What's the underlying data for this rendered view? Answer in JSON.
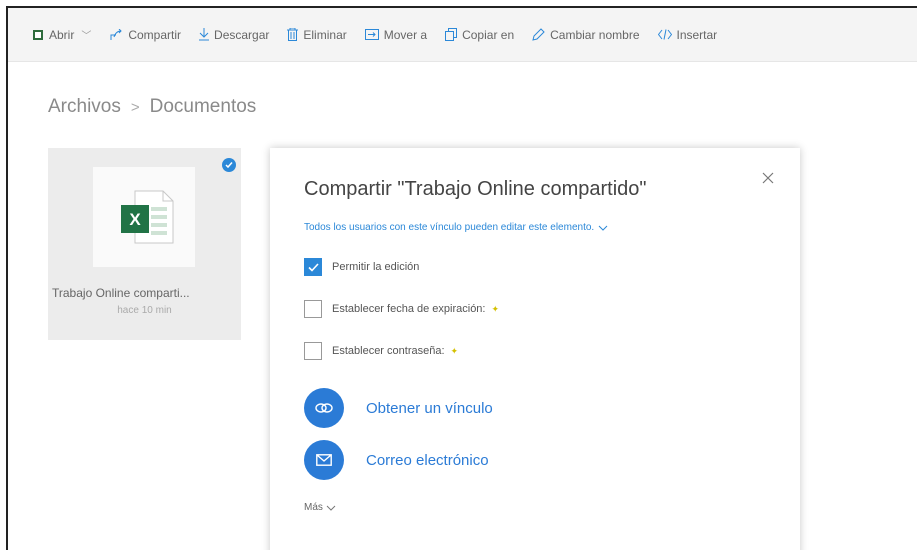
{
  "toolbar": {
    "items": [
      {
        "label": "Abrir",
        "icon": "open-icon"
      },
      {
        "label": "Compartir",
        "icon": "share-icon"
      },
      {
        "label": "Descargar",
        "icon": "download-icon"
      },
      {
        "label": "Eliminar",
        "icon": "trash-icon"
      },
      {
        "label": "Mover a",
        "icon": "move-icon"
      },
      {
        "label": "Copiar en",
        "icon": "copy-icon"
      },
      {
        "label": "Cambiar nombre",
        "icon": "pencil-icon"
      },
      {
        "label": "Insertar",
        "icon": "embed-icon"
      }
    ]
  },
  "breadcrumb": {
    "root": "Archivos",
    "separator": ">",
    "current": "Documentos"
  },
  "file": {
    "name": "Trabajo Online comparti...",
    "time": "hace 10 min",
    "icon": "excel-file-icon"
  },
  "share_dialog": {
    "title": "Compartir \"Trabajo Online compartido\"",
    "subtitle": "Todos los usuarios con este vínculo pueden editar este elemento.",
    "options": {
      "allow_edit": {
        "label": "Permitir la edición",
        "checked": true
      },
      "expiration": {
        "label": "Establecer fecha de expiración:",
        "checked": false
      },
      "password": {
        "label": "Establecer contraseña:",
        "checked": false
      }
    },
    "actions": {
      "get_link": "Obtener un vínculo",
      "email": "Correo electrónico"
    },
    "more": "Más"
  },
  "colors": {
    "accent": "#2b7bd6",
    "toolbar_bg": "#f4f4f4",
    "tile_bg": "#ececec",
    "excel_green": "#217346",
    "star": "#d4c000"
  }
}
